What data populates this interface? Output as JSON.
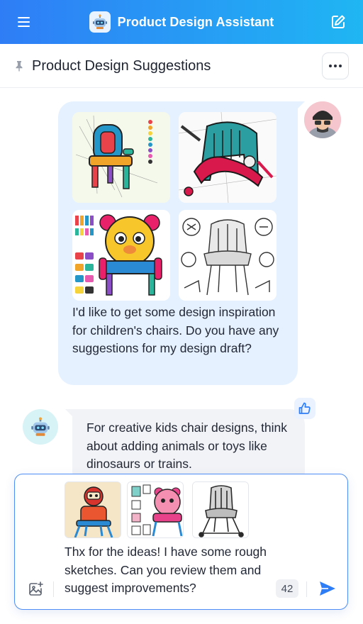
{
  "header": {
    "title": "Product Design Assistant",
    "menu_icon": "hamburger-menu-icon",
    "logo_icon": "robot-icon",
    "edit_icon": "edit-icon",
    "gradient_start": "#2f7df6",
    "gradient_end": "#1fb6f3"
  },
  "conversation": {
    "title": "Product Design Suggestions",
    "pin_icon": "pin-icon",
    "more_icon": "more-horizontal-icon"
  },
  "messages": {
    "user": {
      "images": [
        "colorful-sketch-chair",
        "teal-magenta-concept-chair",
        "bear-character-chair",
        "pencil-sketch-high-chair"
      ],
      "text": "I'd like to get some design inspiration for children's chairs. Do you have any suggestions for my design draft?"
    },
    "assistant": {
      "text": "For creative kids chair designs, think about adding animals or toys like dinosaurs or trains.",
      "feedback_icon": "thumbs-up-icon"
    }
  },
  "composer": {
    "attachments": [
      "robot-chair-sketch",
      "pink-character-chair-sketch",
      "gray-high-chair-sketch"
    ],
    "text": "Thx for the ideas! I have some rough sketches. Can you review them and suggest improvements?",
    "char_count": "42",
    "add_image_icon": "add-image-icon",
    "send_icon": "send-icon",
    "accent_color": "#2f7df6"
  }
}
